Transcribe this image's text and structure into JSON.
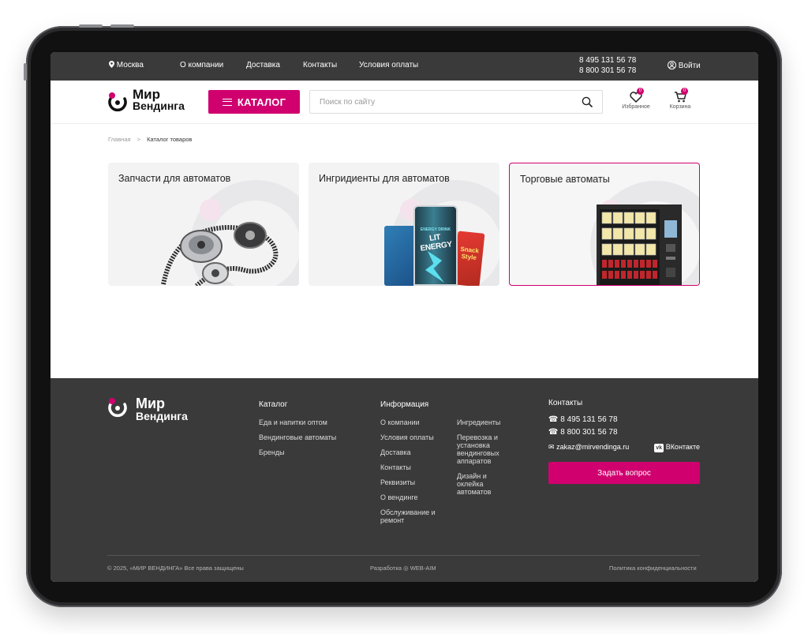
{
  "topbar": {
    "city": "Москва",
    "nav": [
      "О компании",
      "Доставка",
      "Контакты",
      "Условия оплаты"
    ],
    "phone1": "8 495 131 56 78",
    "phone2": "8 800 301 56 78",
    "login": "Войти"
  },
  "header": {
    "logo_line1": "Мир",
    "logo_line2": "Вендинга",
    "catalog_label": "КАТАЛОГ",
    "search_placeholder": "Поиск по сайту",
    "favorites_label": "Избранное",
    "favorites_count": "0",
    "cart_label": "Корзина",
    "cart_count": "0"
  },
  "breadcrumb": {
    "home": "Главная",
    "separator": ">",
    "current": "Каталог товаров"
  },
  "categories": [
    {
      "title": "Запчасти для автоматов",
      "image": "timing-belt-pulleys"
    },
    {
      "title": "Ингридиенты для автоматов",
      "image": "energy-drink-snacks",
      "can_text": "LIT ENERGY",
      "can_sub": "ENERGY DRINK",
      "snack_text": "Snack Style"
    },
    {
      "title": "Торговые автоматы",
      "image": "vending-machine",
      "active": true
    }
  ],
  "footer": {
    "logo_line1": "Мир",
    "logo_line2": "Вендинга",
    "catalog_title": "Каталог",
    "catalog_links": [
      "Еда и напитки оптом",
      "Вендинговые автоматы",
      "Бренды"
    ],
    "info_title": "Информация",
    "info_links_1": [
      "О компании",
      "Условия оплаты",
      "Доставка",
      "Контакты",
      "Реквизиты",
      "О вендинге",
      "Обслуживание и ремонт"
    ],
    "info_links_2": [
      "Ингредиенты",
      "Перевозка и установка вендинговых аппаратов",
      "Дизайн и оклейка автоматов"
    ],
    "contacts_title": "Контакты",
    "phone1": "8 495 131 56 78",
    "phone2": "8 800 301 56 78",
    "email": "zakaz@mirvendinga.ru",
    "vk_label": "ВКонтакте",
    "ask_button": "Задать вопрос",
    "copyright": "© 2025, «МИР ВЕНДИНГА» Все права защищены",
    "developer_prefix": "Разработка",
    "developer_name": "WEB-AIM",
    "privacy": "Политика конфиденциальности"
  },
  "colors": {
    "accent": "#d0006f",
    "dark": "#3a3a3a"
  }
}
